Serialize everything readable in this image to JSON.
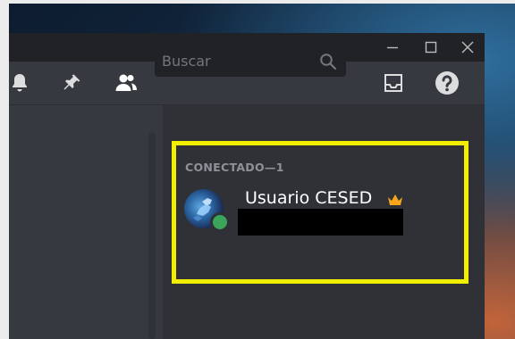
{
  "window": {
    "controls": [
      "minimize",
      "maximize",
      "close"
    ]
  },
  "toolbar": {
    "icons": [
      "bell-icon",
      "pin-icon",
      "members-icon",
      "inbox-icon",
      "help-icon"
    ]
  },
  "search": {
    "placeholder": "Buscar"
  },
  "member_list": {
    "section_header": "CONECTADO—1",
    "members": [
      {
        "name": "Usuario CESED",
        "status": "online",
        "owner_badge": "crown-icon"
      }
    ]
  },
  "colors": {
    "highlight": "#f2ee00",
    "online": "#3ba55c",
    "crown": "#faa61a"
  }
}
